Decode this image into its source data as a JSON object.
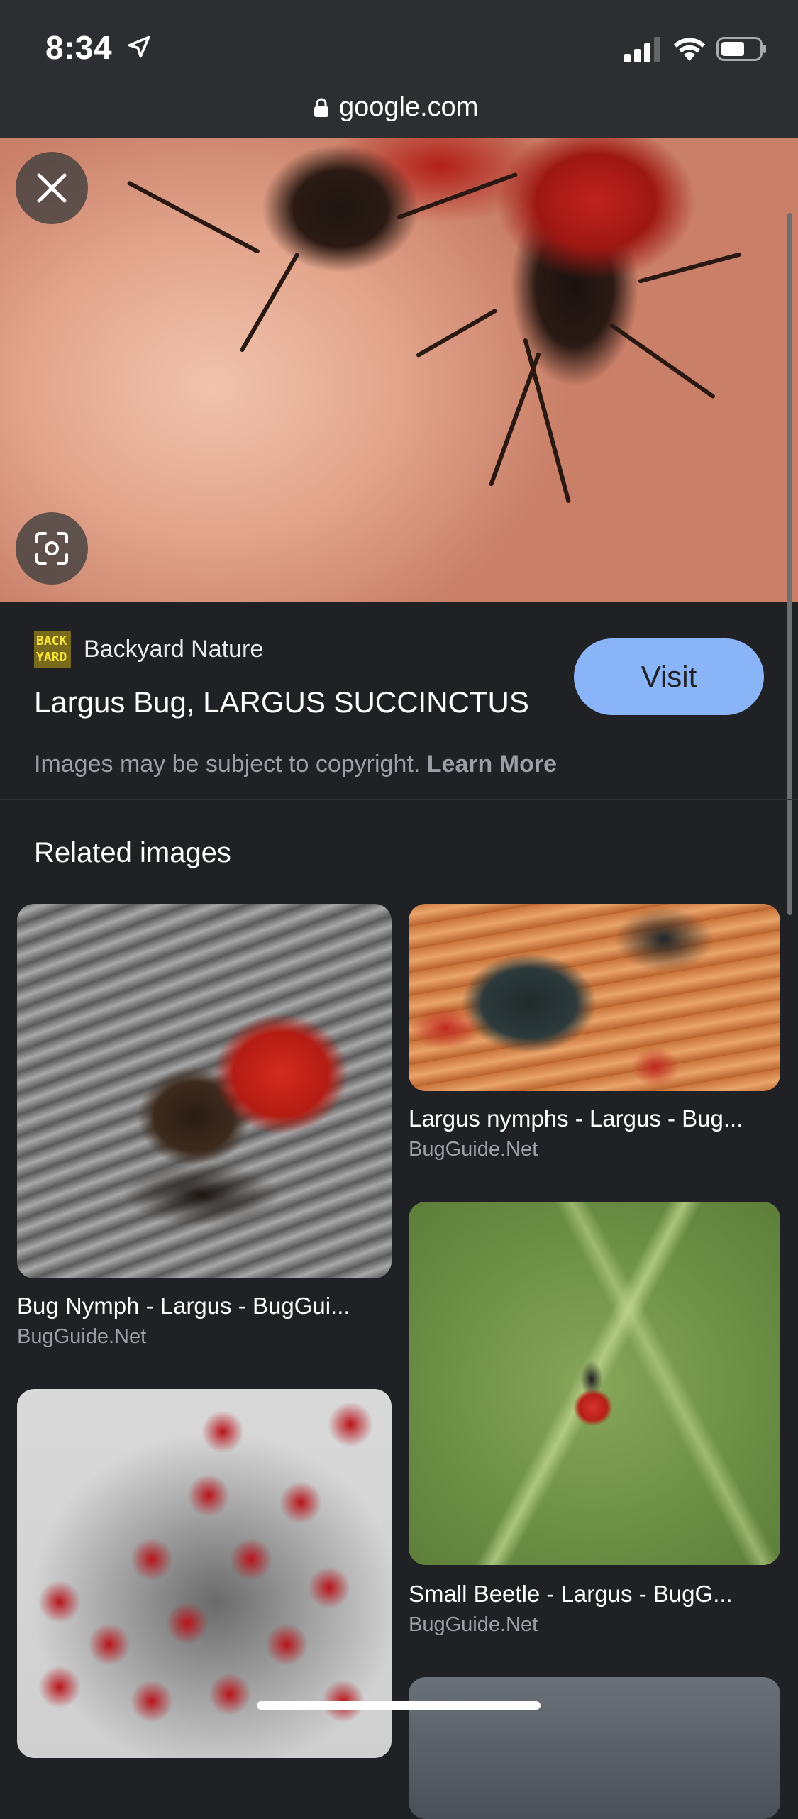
{
  "status_bar": {
    "time": "8:34"
  },
  "url_bar": {
    "domain": "google.com"
  },
  "result": {
    "source_logo_text": "BACK YARD",
    "source_name": "Backyard Nature",
    "title": "Largus Bug, LARGUS SUCCINCTUS",
    "visit_label": "Visit",
    "copyright_text": "Images may be subject to copyright.",
    "learn_more_label": "Learn More"
  },
  "related": {
    "heading": "Related images",
    "items": [
      {
        "title": "Bug Nymph - Largus - BugGui...",
        "source": "BugGuide.Net"
      },
      {
        "title": "Largus nymphs - Largus - Bug...",
        "source": "BugGuide.Net"
      },
      {
        "title": "Small Beetle - Largus - BugG...",
        "source": "BugGuide.Net"
      }
    ]
  },
  "icons": [
    "location-arrow-icon",
    "signal-icon",
    "wifi-icon",
    "battery-icon",
    "lock-icon",
    "close-icon",
    "lens-icon"
  ],
  "colors": {
    "accent": "#8ab4f8",
    "background": "#202124",
    "bar": "#2d2e31"
  }
}
